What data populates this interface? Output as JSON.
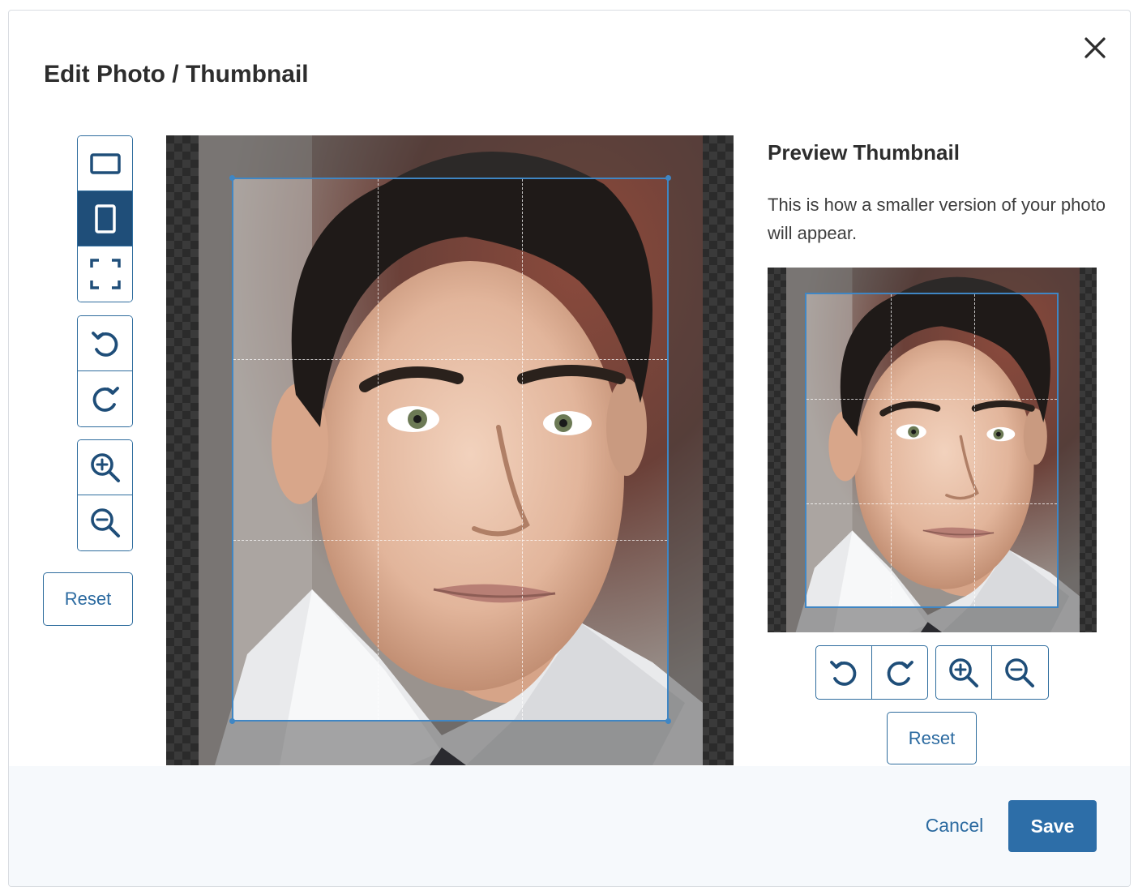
{
  "dialog": {
    "title": "Edit Photo / Thumbnail",
    "close_icon": "close-icon"
  },
  "toolbar": {
    "aspect_tools": [
      {
        "icon": "landscape-crop-icon",
        "active": false
      },
      {
        "icon": "portrait-crop-icon",
        "active": true
      },
      {
        "icon": "free-crop-icon",
        "active": false
      }
    ],
    "rotate_tools": [
      {
        "icon": "rotate-left-icon"
      },
      {
        "icon": "rotate-right-icon"
      }
    ],
    "zoom_tools": [
      {
        "icon": "zoom-in-icon"
      },
      {
        "icon": "zoom-out-icon"
      }
    ],
    "reset_label": "Reset"
  },
  "preview": {
    "title": "Preview Thumbnail",
    "description": "This is how a smaller version of your photo will appear.",
    "reset_label": "Reset",
    "controls": [
      "rotate-left-icon",
      "rotate-right-icon",
      "zoom-in-icon",
      "zoom-out-icon"
    ]
  },
  "footer": {
    "cancel_label": "Cancel",
    "save_label": "Save"
  },
  "colors": {
    "accent": "#2d6ea8",
    "active_tool": "#1f4e79",
    "crop_border": "#3f86c4",
    "footer_bg": "#f6f9fc"
  }
}
